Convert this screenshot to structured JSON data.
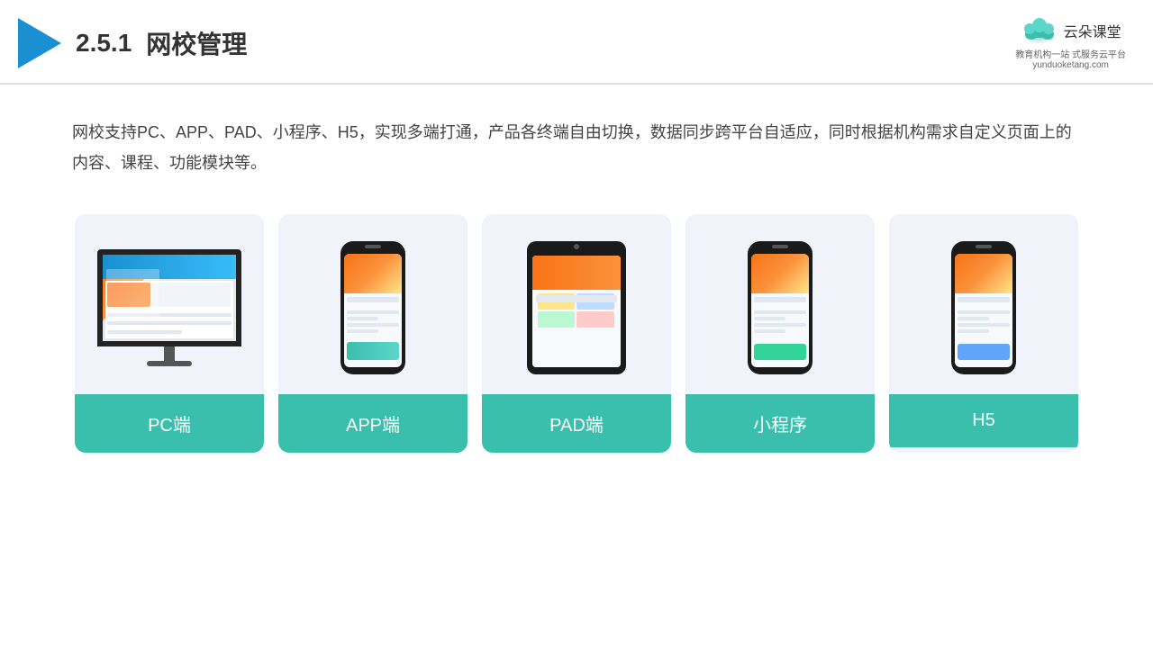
{
  "header": {
    "section_number": "2.5.1",
    "title": "网校管理",
    "brand_name": "云朵课堂",
    "brand_url": "yunduoketang.com",
    "brand_tagline": "教育机构一站\n式服务云平台"
  },
  "description": {
    "text": "网校支持PC、APP、PAD、小程序、H5，实现多端打通，产品各终端自由切换，数据同步跨平台自适应，同时根据机构需求自定义页面上的内容、课程、功能模块等。"
  },
  "cards": [
    {
      "id": "pc",
      "label": "PC端",
      "device_type": "monitor"
    },
    {
      "id": "app",
      "label": "APP端",
      "device_type": "phone_app"
    },
    {
      "id": "pad",
      "label": "PAD端",
      "device_type": "tablet"
    },
    {
      "id": "miniapp",
      "label": "小程序",
      "device_type": "phone_mini"
    },
    {
      "id": "h5",
      "label": "H5",
      "device_type": "phone_h5"
    }
  ],
  "colors": {
    "teal": "#3bbfad",
    "blue_accent": "#1a8fd1",
    "bg_card": "#f0f4fa",
    "text_dark": "#333",
    "text_body": "#444"
  }
}
